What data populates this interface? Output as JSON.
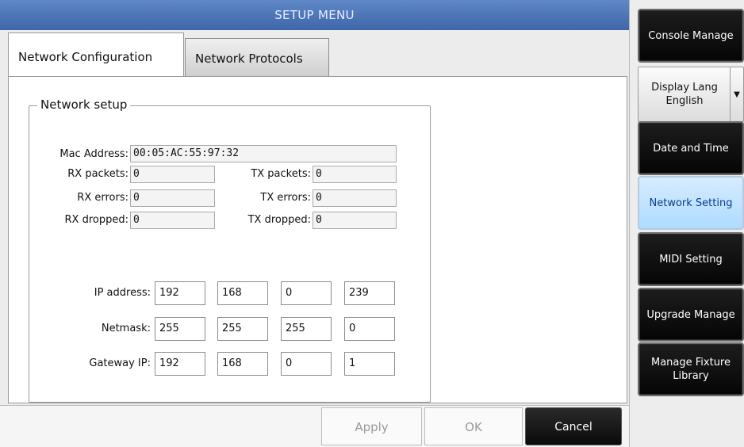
{
  "window": {
    "title": "SETUP MENU"
  },
  "tabs": {
    "active": "Network Configuration",
    "inactive": "Network Protocols"
  },
  "group": {
    "label": "Network setup"
  },
  "info": {
    "mac_label": "Mac Address:",
    "mac_value": "00:05:AC:55:97:32",
    "rx_packets_label": "RX packets:",
    "rx_packets": "0",
    "tx_packets_label": "TX packets:",
    "tx_packets": "0",
    "rx_errors_label": "RX errors:",
    "rx_errors": "0",
    "tx_errors_label": "TX errors:",
    "tx_errors": "0",
    "rx_dropped_label": "RX dropped:",
    "rx_dropped": "0",
    "tx_dropped_label": "TX dropped:",
    "tx_dropped": "0"
  },
  "ip": {
    "ip_label": "IP address:",
    "ip": [
      "192",
      "168",
      "0",
      "239"
    ],
    "netmask_label": "Netmask:",
    "netmask": [
      "255",
      "255",
      "255",
      "0"
    ],
    "gateway_label": "Gateway IP:",
    "gateway": [
      "192",
      "168",
      "0",
      "1"
    ]
  },
  "buttons": {
    "apply": "Apply",
    "ok": "OK",
    "cancel": "Cancel"
  },
  "sidebar": {
    "console_manage": "Console Manage",
    "display_lang_title": "Display Lang",
    "display_lang_value": "English",
    "date_time": "Date and Time",
    "network_setting": "Network Setting",
    "midi_setting": "MIDI Setting",
    "upgrade_manage": "Upgrade Manage",
    "manage_fixture_line1": "Manage Fixture",
    "manage_fixture_line2": "Library"
  },
  "colors": {
    "title_bar": "#4a73b8",
    "active_side": "#bfe3ff",
    "dark_button": "#111111"
  },
  "icons": {
    "dropdown": "chevron-down-icon"
  }
}
